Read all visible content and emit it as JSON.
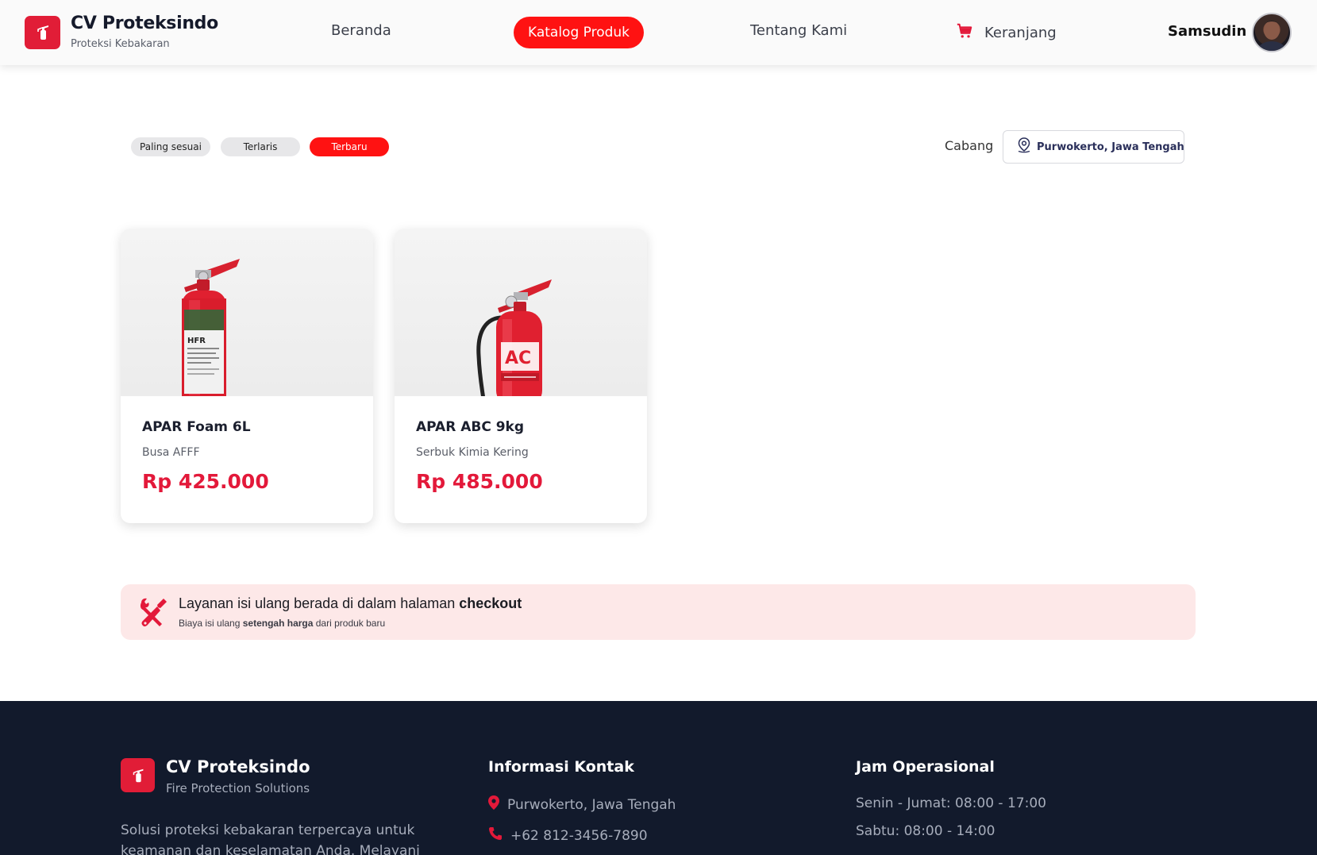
{
  "brand": {
    "name": "CV Proteksindo",
    "tagline": "Proteksi Kebakaran",
    "accent": "#e11d37"
  },
  "nav": {
    "home": "Beranda",
    "catalog": "Katalog Produk",
    "about": "Tentang Kami",
    "cart": "Keranjang",
    "active_color": "#ff1212"
  },
  "user": {
    "name": "Samsudin"
  },
  "filters": {
    "sort_options": [
      "Paling sesuai",
      "Terlaris",
      "Terbaru"
    ],
    "selected": "Terbaru",
    "branch_label": "Cabang",
    "branch_value": "Purwokerto, Jawa Tengah"
  },
  "products": [
    {
      "name": "APAR Foam 6L",
      "type": "Busa AFFF",
      "price": "Rp 425.000",
      "label_text": "HFR"
    },
    {
      "name": "APAR ABC 9kg",
      "type": "Serbuk Kimia Kering",
      "price": "Rp 485.000",
      "label_text": "AC"
    }
  ],
  "banner": {
    "title_prefix": "Layanan isi ulang berada di dalam halaman ",
    "title_bold": "checkout",
    "sub_prefix": "Biaya isi ulang ",
    "sub_bold": "setengah harga",
    "sub_suffix": " dari produk baru"
  },
  "footer": {
    "brand": "CV Proteksindo",
    "tagline": "Fire Protection Solutions",
    "description": "Solusi proteksi kebakaran terpercaya untuk keamanan dan keselamatan Anda. Melayani",
    "contact_heading": "Informasi Kontak",
    "address": "Purwokerto, Jawa Tengah",
    "phone": "+62 812-3456-7890",
    "hours_heading": "Jam Operasional",
    "weekday_hours": "Senin - Jumat: 08:00 - 17:00",
    "saturday_hours": "Sabtu: 08:00 - 14:00"
  }
}
